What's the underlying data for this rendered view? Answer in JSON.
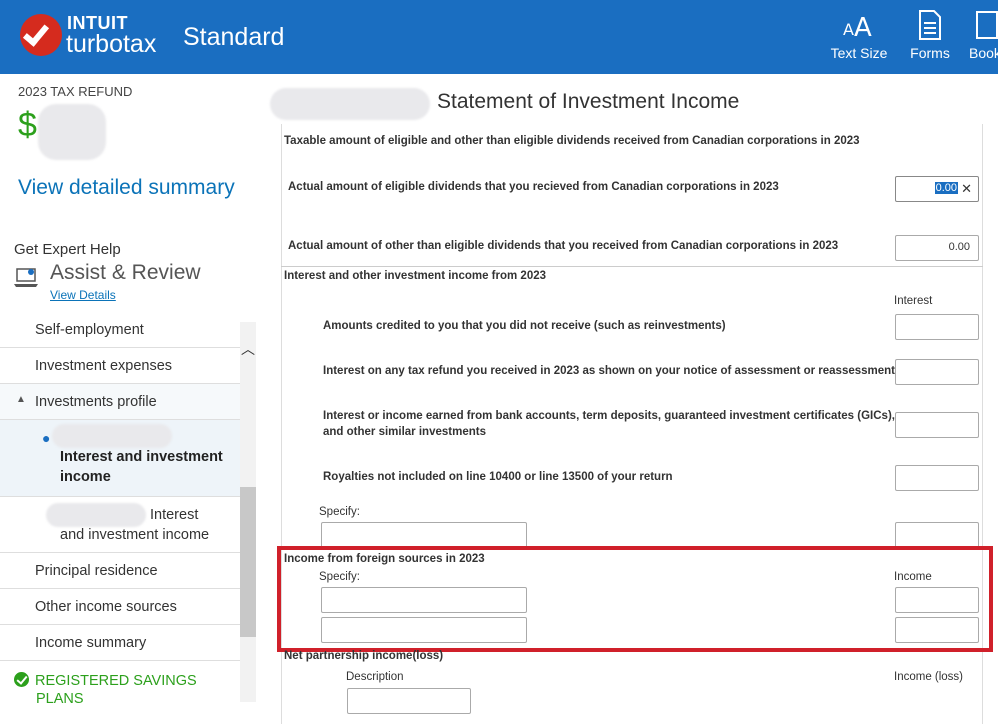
{
  "header": {
    "brand_top": "INTUIT",
    "brand_bottom": "turbotax",
    "product": "Standard",
    "buttons": [
      {
        "label": "Text Size",
        "icon": "text-size-icon"
      },
      {
        "label": "Forms",
        "icon": "forms-icon"
      },
      {
        "label": "Book",
        "icon": "book-icon"
      }
    ]
  },
  "sidebar": {
    "refund_label": "2023 TAX REFUND",
    "currency": "$",
    "view_summary": "View detailed summary",
    "expert_help": "Get Expert Help",
    "assist_review": "Assist & Review",
    "view_details": "View Details",
    "nav": {
      "self_employment": "Self-employment",
      "investment_expenses": "Investment expenses",
      "investments_profile": "Investments profile",
      "interest_income_1_line1": "Interest and investment",
      "interest_income_1_line2": "income",
      "interest_income_2_line1": "Interest",
      "interest_income_2_line2": "and investment income",
      "principal_residence": "Principal residence",
      "other_income": "Other income sources",
      "income_summary": "Income summary"
    },
    "registered_line1": "REGISTERED SAVINGS",
    "registered_line2": "PLANS"
  },
  "main": {
    "title": "Statement of Investment Income",
    "dividends_heading": "Taxable amount of eligible and other than eligible dividends received from Canadian corporations in 2023",
    "eligible_label": "Actual amount of eligible dividends that you recieved from Canadian corporations in 2023",
    "eligible_value": "0.00",
    "other_label": "Actual amount of other than eligible dividends that you received from Canadian corporations in 2023",
    "other_value": "0.00",
    "interest_heading": "Interest and other investment income from 2023",
    "interest_col": "Interest",
    "reinvest_label": "Amounts credited to you that you did not receive (such as reinvestments)",
    "refund_interest_label": "Interest on any tax refund you received in 2023 as shown on your notice of assessment or reassessment",
    "bank_label_line1": "Interest or income earned from bank accounts, term deposits, guaranteed investment certificates (GICs),",
    "bank_label_line2": "and other similar investments",
    "royalties_label": "Royalties not included on line 10400 or line 13500 of your return",
    "specify_label": "Specify:",
    "foreign_heading": "Income from foreign sources in 2023",
    "foreign_specify": "Specify:",
    "foreign_income_col": "Income",
    "partnership_heading": "Net partnership income(loss)",
    "description_label": "Description",
    "income_loss_col": "Income (loss)"
  },
  "colors": {
    "header_bg": "#1a6ec1",
    "link": "#0b73b8",
    "success": "#2ca01c",
    "highlight": "#d0202a"
  }
}
